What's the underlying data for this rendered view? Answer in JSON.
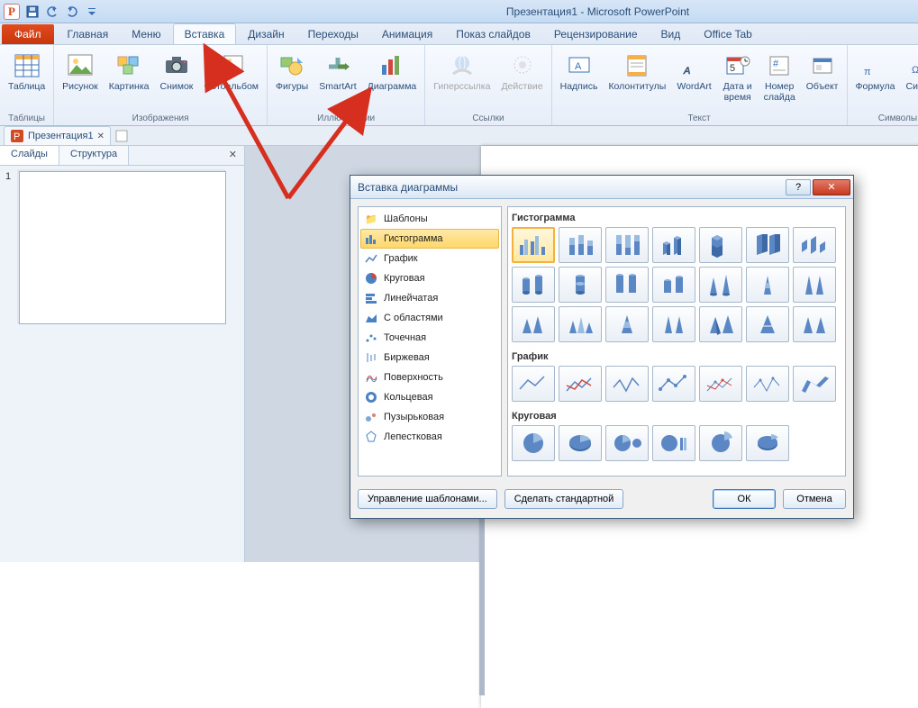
{
  "titlebar": {
    "title": "Презентация1 - Microsoft PowerPoint"
  },
  "tabs": {
    "file": "Файл",
    "list": [
      "Главная",
      "Меню",
      "Вставка",
      "Дизайн",
      "Переходы",
      "Анимация",
      "Показ слайдов",
      "Рецензирование",
      "Вид",
      "Office Tab"
    ],
    "active": "Вставка"
  },
  "ribbon": {
    "groups": {
      "tables": {
        "label": "Таблицы",
        "items": {
          "table": "Таблица"
        }
      },
      "images": {
        "label": "Изображения",
        "items": {
          "picture": "Рисунок",
          "clipart": "Картинка",
          "snapshot": "Снимок",
          "album": "Фотоальбом"
        }
      },
      "illustrations": {
        "label": "Иллюстрации",
        "items": {
          "shapes": "Фигуры",
          "smartart": "SmartArt",
          "chart": "Диаграмма"
        }
      },
      "links": {
        "label": "Ссылки",
        "items": {
          "hyperlink": "Гиперссылка",
          "action": "Действие"
        }
      },
      "text": {
        "label": "Текст",
        "items": {
          "textbox": "Надпись",
          "headerfooter": "Колонтитулы",
          "wordart": "WordArt",
          "datetime": "Дата и\nвремя",
          "slidenum": "Номер\nслайда",
          "object": "Объект"
        }
      },
      "symbols": {
        "label": "Символы",
        "items": {
          "equation": "Формула",
          "symbol": "Символ"
        }
      }
    }
  },
  "doc_tabs": {
    "name": "Презентация1"
  },
  "side": {
    "tabs": {
      "slides": "Слайды",
      "outline": "Структура"
    },
    "slide_num": "1"
  },
  "dialog": {
    "title": "Вставка диаграммы",
    "categories": [
      "Шаблоны",
      "Гистограмма",
      "График",
      "Круговая",
      "Линейчатая",
      "С областями",
      "Точечная",
      "Биржевая",
      "Поверхность",
      "Кольцевая",
      "Пузырьковая",
      "Лепестковая"
    ],
    "active_category": "Гистограмма",
    "sections": {
      "hist": "Гистограмма",
      "line": "График",
      "pie": "Круговая"
    },
    "footer": {
      "templates": "Управление шаблонами...",
      "default": "Сделать стандартной",
      "ok": "ОК",
      "cancel": "Отмена"
    }
  }
}
